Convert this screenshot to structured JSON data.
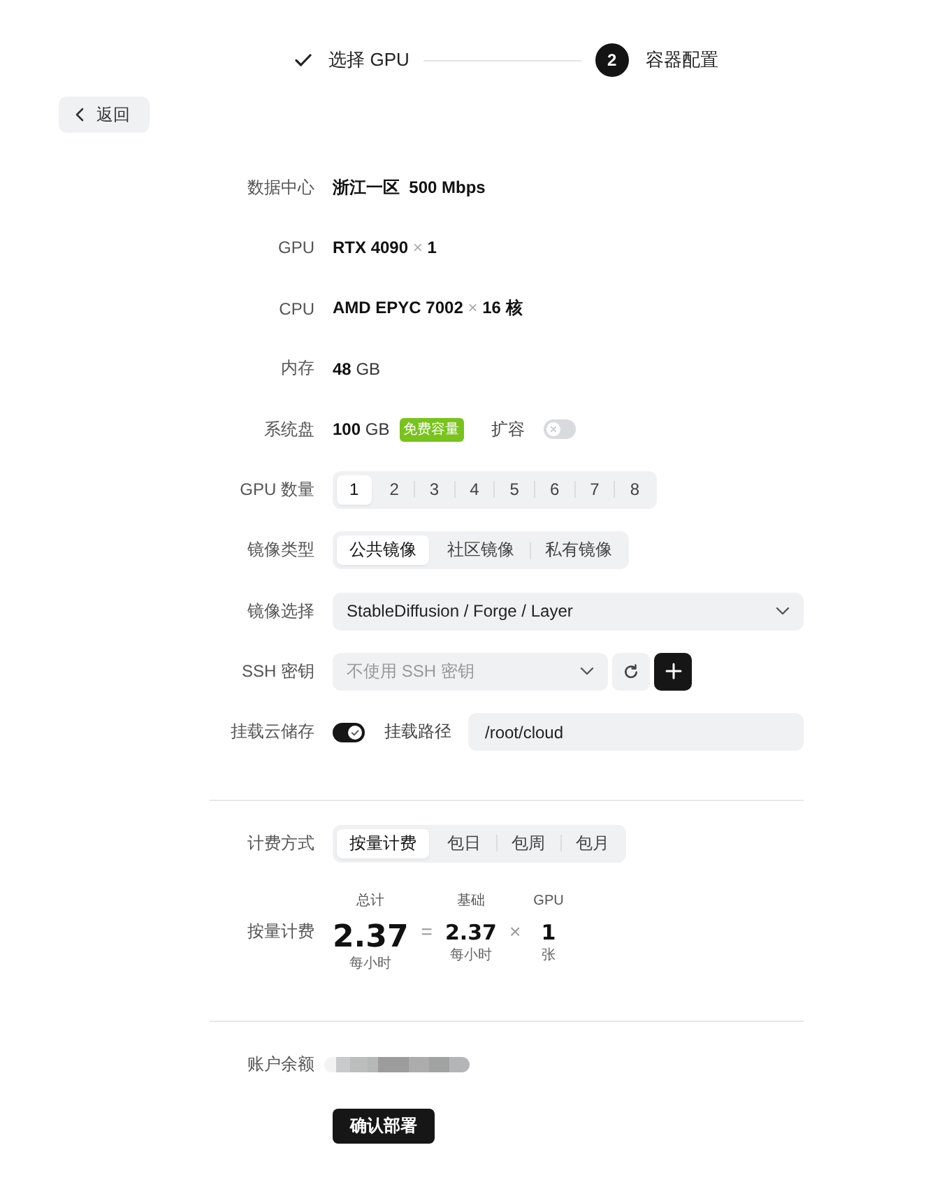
{
  "stepper": {
    "steps": [
      {
        "label": "选择 GPU",
        "completed": true
      },
      {
        "label": "容器配置",
        "completed": false,
        "number": "2"
      }
    ]
  },
  "back_button": {
    "label": "返回"
  },
  "sections": [
    {
      "rows": [
        {
          "kind": "text",
          "label": "数据中心",
          "value": "浙江一区  500 Mbps"
        },
        {
          "kind": "text",
          "label": "GPU",
          "value": "RTX 4090",
          "multiplier": {
            "sign": "×",
            "count": "1"
          }
        },
        {
          "kind": "text",
          "label": "CPU",
          "value": "AMD EPYC 7002",
          "multiplier": {
            "sign": "×",
            "count": "16 核"
          }
        },
        {
          "kind": "text",
          "label": "内存",
          "value": "48",
          "unit": "GB"
        },
        {
          "kind": "text",
          "label": "系统盘",
          "value": "100",
          "unit": "GB",
          "badge": "免费容量",
          "expand": {
            "label": "扩容",
            "on": false
          }
        },
        {
          "kind": "segmented",
          "label": "GPU 数量",
          "options": [
            {
              "label": "1",
              "selected": true
            },
            {
              "label": "2",
              "selected": false
            },
            {
              "label": "3",
              "selected": false
            },
            {
              "label": "4",
              "selected": false
            },
            {
              "label": "5",
              "selected": false
            },
            {
              "label": "6",
              "selected": false
            },
            {
              "label": "7",
              "selected": false
            },
            {
              "label": "8",
              "selected": false
            }
          ]
        },
        {
          "kind": "segmented",
          "label": "镜像类型",
          "options": [
            {
              "label": "公共镜像",
              "selected": true
            },
            {
              "label": "社区镜像",
              "selected": false
            },
            {
              "label": "私有镜像",
              "selected": false
            }
          ]
        },
        {
          "kind": "select",
          "label": "镜像选择",
          "value": "StableDiffusion / Forge / Layer"
        },
        {
          "kind": "key_select",
          "label": "SSH 密钥",
          "placeholder": "不使用 SSH 密钥"
        },
        {
          "kind": "mount",
          "label": "挂载云储存",
          "enabled": true,
          "path_label": "挂载路径",
          "path": "/root/cloud"
        }
      ]
    },
    {
      "rows": [
        {
          "kind": "segmented",
          "label": "计费方式",
          "options": [
            {
              "label": "按量计费",
              "selected": true
            },
            {
              "label": "包日",
              "selected": false
            },
            {
              "label": "包周",
              "selected": false
            },
            {
              "label": "包月",
              "selected": false
            }
          ]
        },
        {
          "kind": "price",
          "label": "按量计费",
          "terms": [
            {
              "kind": "total",
              "caption": "总计",
              "value": "2.37",
              "unit": "每小时"
            },
            {
              "kind": "operator",
              "symbol": "="
            },
            {
              "kind": "factor",
              "caption": "基础",
              "value": "2.37",
              "unit": "每小时"
            },
            {
              "kind": "operator",
              "symbol": "×"
            },
            {
              "kind": "factor",
              "caption": "GPU",
              "value": "1",
              "unit": "张"
            }
          ]
        }
      ]
    },
    {
      "rows": [
        {
          "kind": "redacted",
          "label": "账户余额"
        }
      ]
    }
  ],
  "submit_button": {
    "label": "确认部署"
  }
}
